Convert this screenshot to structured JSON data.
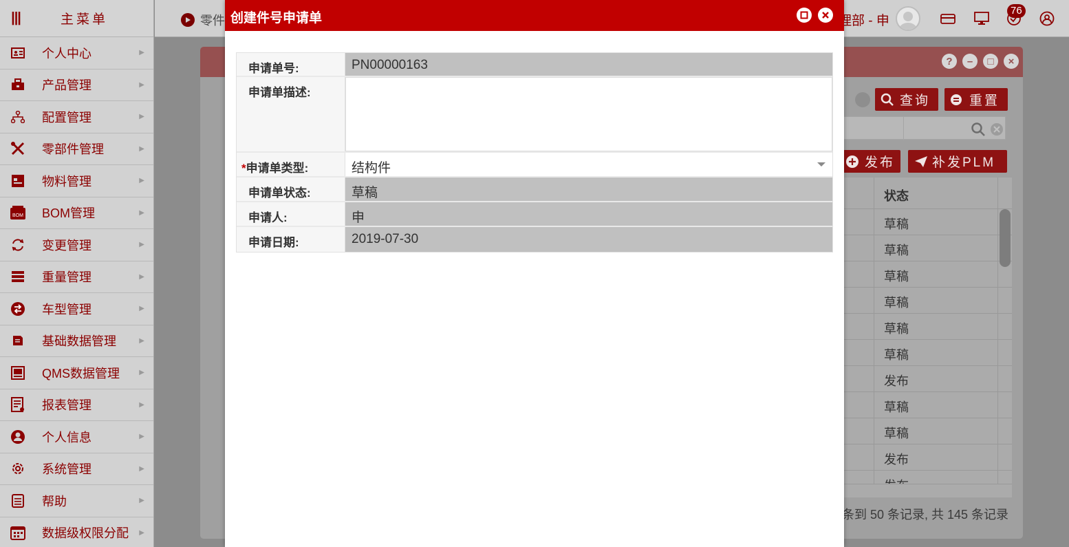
{
  "sidebar": {
    "title": "主菜单",
    "items": [
      {
        "label": "个人中心",
        "icon": "id-card-icon"
      },
      {
        "label": "产品管理",
        "icon": "product-icon"
      },
      {
        "label": "配置管理",
        "icon": "hierarchy-icon"
      },
      {
        "label": "零部件管理",
        "icon": "tools-icon"
      },
      {
        "label": "物料管理",
        "icon": "material-icon"
      },
      {
        "label": "BOM管理",
        "icon": "bom-icon"
      },
      {
        "label": "变更管理",
        "icon": "refresh-icon"
      },
      {
        "label": "重量管理",
        "icon": "weight-icon"
      },
      {
        "label": "车型管理",
        "icon": "swap-icon"
      },
      {
        "label": "基础数据管理",
        "icon": "document-icon"
      },
      {
        "label": "QMS数据管理",
        "icon": "qms-icon"
      },
      {
        "label": "报表管理",
        "icon": "report-icon"
      },
      {
        "label": "个人信息",
        "icon": "user-icon"
      },
      {
        "label": "系统管理",
        "icon": "gear-icon"
      },
      {
        "label": "帮助",
        "icon": "help-doc-icon"
      },
      {
        "label": "数据级权限分配",
        "icon": "calendar-icon"
      }
    ]
  },
  "topbar": {
    "tab_label": "零件",
    "user_label": "理部 - 申",
    "badge_count": "76"
  },
  "background": {
    "query_button": "查询",
    "reset_button": "重置",
    "publish_button": "发布",
    "reissue_button": "补发PLM",
    "status_header": "状态",
    "status_values": [
      "草稿",
      "草稿",
      "草稿",
      "草稿",
      "草稿",
      "草稿",
      "发布",
      "草稿",
      "草稿",
      "发布",
      "发布"
    ],
    "pager_text": "条到 50 条记录, 共 145 条记录"
  },
  "modal": {
    "title": "创建件号申请单",
    "fields": {
      "number_label": "申请单号:",
      "number_value": "PN00000163",
      "description_label": "申请单描述:",
      "description_value": "",
      "type_label": "申请单类型:",
      "type_value": "结构件",
      "required_mark": "*",
      "status_label": "申请单状态:",
      "status_value": "草稿",
      "applicant_label": "申请人:",
      "applicant_value": "申",
      "date_label": "申请日期:",
      "date_value": "2019-07-30"
    }
  },
  "colors": {
    "brand": "#c10000",
    "sidebar_text": "#8b0000"
  }
}
